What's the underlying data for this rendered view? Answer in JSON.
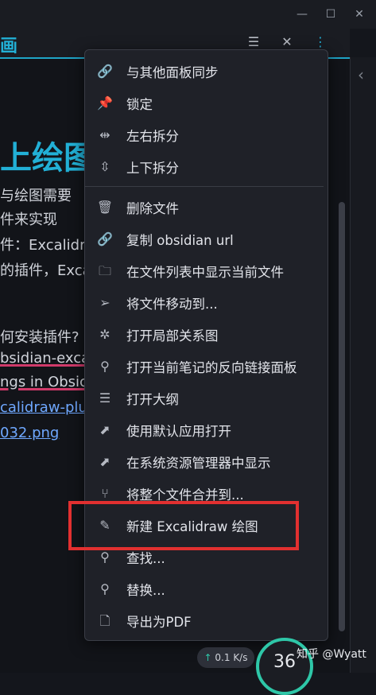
{
  "window": {
    "minimize": "—",
    "maximize": "☐",
    "close": "✕"
  },
  "tab": {
    "title": "画"
  },
  "doc": {
    "heading": "上绘图",
    "lines": [
      "与绘图需要",
      "件来实现",
      "件：Excalidr",
      "的插件，Exca",
      "何安装插件?",
      "bsidian-exca",
      "ngs in Obsic",
      "calidraw-plug",
      "032.png"
    ]
  },
  "menu": {
    "items": [
      {
        "label": "与其他面板同步",
        "icon": "link-icon"
      },
      {
        "label": "锁定",
        "icon": "pin-icon"
      },
      {
        "label": "左右拆分",
        "icon": "split-horizontal-icon"
      },
      {
        "label": "上下拆分",
        "icon": "split-vertical-icon"
      },
      {
        "label": "删除文件",
        "icon": "trash-icon"
      },
      {
        "label": "复制 obsidian url",
        "icon": "link-icon"
      },
      {
        "label": "在文件列表中显示当前文件",
        "icon": "folder-icon"
      },
      {
        "label": "将文件移动到...",
        "icon": "send-icon"
      },
      {
        "label": "打开局部关系图",
        "icon": "graph-icon"
      },
      {
        "label": "打开当前笔记的反向链接面板",
        "icon": "backlink-icon"
      },
      {
        "label": "打开大纲",
        "icon": "outline-icon"
      },
      {
        "label": "使用默认应用打开",
        "icon": "open-external-icon"
      },
      {
        "label": "在系统资源管理器中显示",
        "icon": "open-external-icon"
      },
      {
        "label": "将整个文件合并到...",
        "icon": "merge-icon"
      },
      {
        "label": "新建 Excalidraw 绘图",
        "icon": "pen-icon"
      },
      {
        "label": "查找...",
        "icon": "search-icon"
      },
      {
        "label": "替换...",
        "icon": "search-icon"
      },
      {
        "label": "导出为PDF",
        "icon": "file-icon"
      }
    ]
  },
  "status": {
    "speed_value": "0.1",
    "speed_unit": "K/s",
    "gauge": "36"
  },
  "watermark": "知乎 @Wyatt",
  "colors": {
    "accent": "#22b0d6",
    "highlight": "#e23030",
    "menu_bg": "#1f2128"
  }
}
